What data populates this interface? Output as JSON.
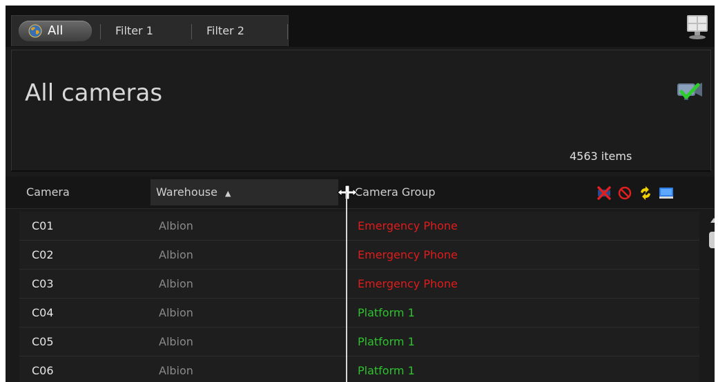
{
  "tabs": {
    "all_label": "All",
    "filter1_label": "Filter 1",
    "filter2_label": "Filter 2"
  },
  "header": {
    "title": "All cameras",
    "item_count": "4563 items"
  },
  "columns": {
    "camera": "Camera",
    "warehouse": "Warehouse",
    "warehouse_sort": "▲",
    "camera_group": "Camera Group"
  },
  "header_icons": [
    "video-off-icon",
    "block-icon",
    "refresh-icon",
    "monitor-icon"
  ],
  "rows": [
    {
      "camera": "C01",
      "warehouse": "Albion",
      "group": "Emergency Phone",
      "group_color": "#e01c1c"
    },
    {
      "camera": "C02",
      "warehouse": "Albion",
      "group": "Emergency Phone",
      "group_color": "#e01c1c"
    },
    {
      "camera": "C03",
      "warehouse": "Albion",
      "group": "Emergency Phone",
      "group_color": "#e01c1c"
    },
    {
      "camera": "C04",
      "warehouse": "Albion",
      "group": "Platform 1",
      "group_color": "#2ec32e"
    },
    {
      "camera": "C05",
      "warehouse": "Albion",
      "group": "Platform 1",
      "group_color": "#2ec32e"
    },
    {
      "camera": "C06",
      "warehouse": "Albion",
      "group": "Platform 1",
      "group_color": "#2ec32e"
    }
  ],
  "colors": {
    "background": "#1a1a1a",
    "emergency": "#e01c1c",
    "platform": "#2ec32e"
  }
}
